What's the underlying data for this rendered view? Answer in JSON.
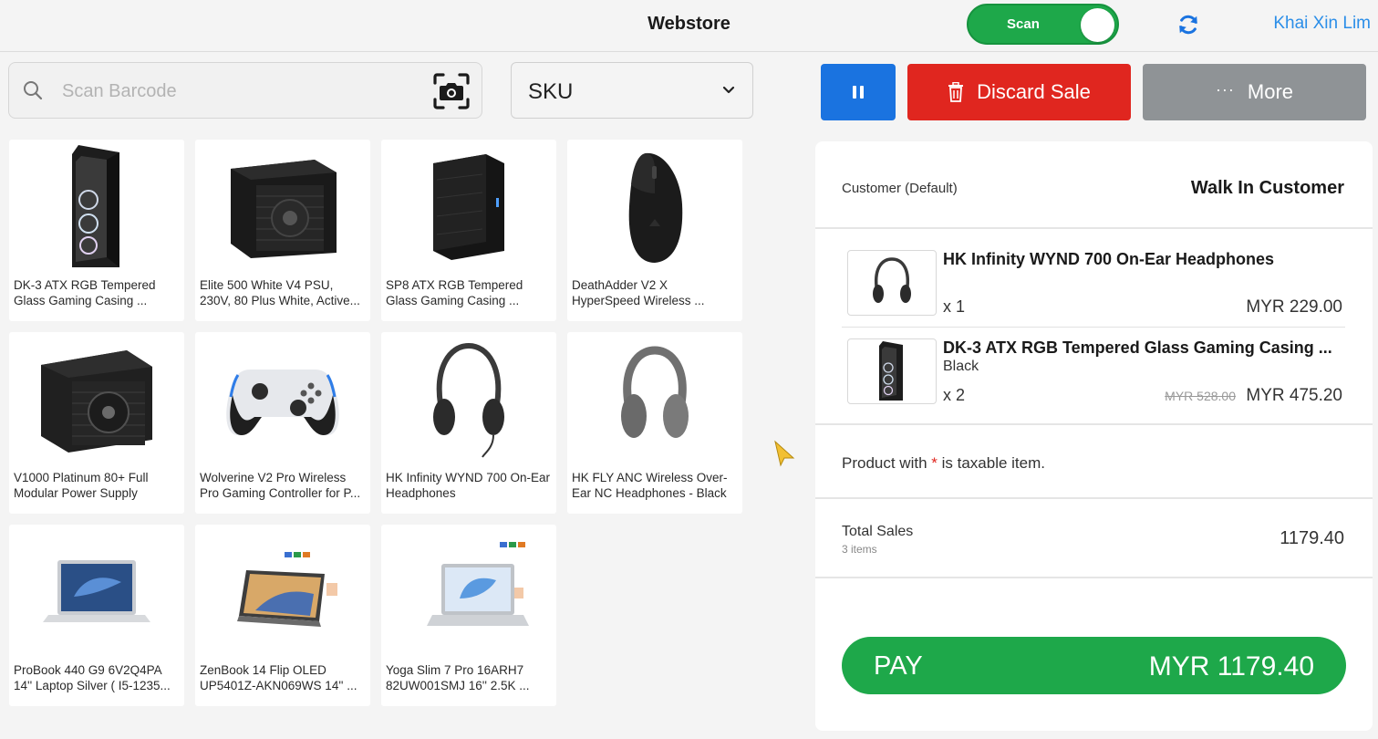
{
  "header": {
    "title": "Webstore",
    "scan_label": "Scan",
    "user": "Khai Xin Lim"
  },
  "search": {
    "placeholder": "Scan Barcode",
    "value": ""
  },
  "filter": {
    "selected": "SKU"
  },
  "actions": {
    "discard_label": "Discard Sale",
    "more_dots": "···",
    "more_label": "More"
  },
  "products": [
    {
      "name": "DK-3 ATX RGB Tempered Glass Gaming Casing ...",
      "icon": "pc-case"
    },
    {
      "name": "Elite 500 White V4 PSU, 230V, 80 Plus White, Active...",
      "icon": "power-supply"
    },
    {
      "name": "SP8 ATX RGB Tempered Glass Gaming Casing ...",
      "icon": "pc-case"
    },
    {
      "name": "DeathAdder V2 X HyperSpeed Wireless ...",
      "icon": "mouse"
    },
    {
      "name": "V1000 Platinum 80+ Full Modular Power Supply",
      "icon": "power-supply"
    },
    {
      "name": "Wolverine V2 Pro Wireless Pro Gaming Controller for P...",
      "icon": "gamepad"
    },
    {
      "name": "HK Infinity WYND 700 On-Ear Headphones",
      "icon": "headphones"
    },
    {
      "name": "HK FLY ANC Wireless Over-Ear NC Headphones - Black",
      "icon": "headphones"
    },
    {
      "name": "ProBook 440 G9 6V2Q4PA 14'' Laptop Silver ( I5-1235...",
      "icon": "laptop"
    },
    {
      "name": "ZenBook 14 Flip OLED UP5401Z-AKN069WS 14'' ...",
      "icon": "laptop"
    },
    {
      "name": "Yoga Slim 7 Pro 16ARH7 82UW001SMJ 16'' 2.5K ...",
      "icon": "laptop"
    }
  ],
  "cart": {
    "customer_label": "Customer  (Default)",
    "customer_name": "Walk In Customer",
    "lines": [
      {
        "title": "HK Infinity WYND 700 On-Ear Headphones",
        "variant": "",
        "qty": "x 1",
        "original_price": "",
        "price": "MYR 229.00",
        "icon": "headphones"
      },
      {
        "title": "DK-3 ATX RGB Tempered Glass Gaming Casing ...",
        "variant": "Black",
        "qty": "x 2",
        "original_price": "MYR 528.00",
        "price": "MYR 475.20",
        "icon": "pc-case"
      }
    ],
    "tax_note_before": "Product with ",
    "tax_star": "*",
    "tax_note_after": " is taxable item.",
    "total_label": "Total Sales",
    "total_items": "3 items",
    "total_value": "1179.40",
    "pay_label": "PAY",
    "pay_amount": "MYR 1179.40"
  },
  "colors": {
    "accent_green": "#1ea84a",
    "accent_blue": "#1a73e0",
    "danger_red": "#e0261f",
    "neutral_grey": "#8f9396",
    "link_blue": "#2b8ee8"
  }
}
